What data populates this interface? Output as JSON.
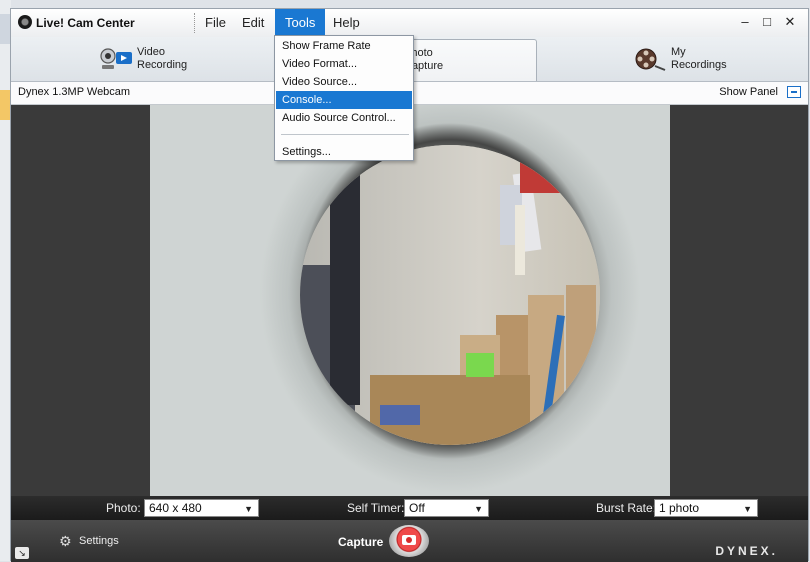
{
  "app": {
    "title": "Live! Cam Center",
    "menu": [
      "File",
      "Edit",
      "Tools",
      "Help"
    ],
    "active_menu": "Tools",
    "window_controls": [
      "minimize-icon",
      "maximize-icon",
      "close-icon"
    ]
  },
  "tabs": [
    {
      "label": "Video\nRecording",
      "icon": "webcam-icon",
      "selected": false
    },
    {
      "label": "Photo\nCapture",
      "icon": "photo-camera-icon",
      "selected": true
    },
    {
      "label": "My\nRecordings",
      "icon": "film-reel-icon",
      "selected": false
    }
  ],
  "camera": {
    "name": "Dynex 1.3MP Webcam",
    "show_panel_label": "Show Panel"
  },
  "tools_menu": {
    "items": [
      "Show Frame Rate",
      "Video Format...",
      "Video Source...",
      "Console...",
      "Audio Source Control...",
      "Settings..."
    ],
    "highlighted": "Console..."
  },
  "controls": {
    "photo_label": "Photo:",
    "photo_value": "640 x 480",
    "timer_label": "Self Timer:",
    "timer_value": "Off",
    "burst_label": "Burst Rate:",
    "burst_value": "1 photo"
  },
  "footer": {
    "settings_label": "Settings",
    "capture_label": "Capture",
    "brand": "DYNEX."
  },
  "colors": {
    "accent": "#1a78d2",
    "capture_red": "#d62b2b"
  }
}
